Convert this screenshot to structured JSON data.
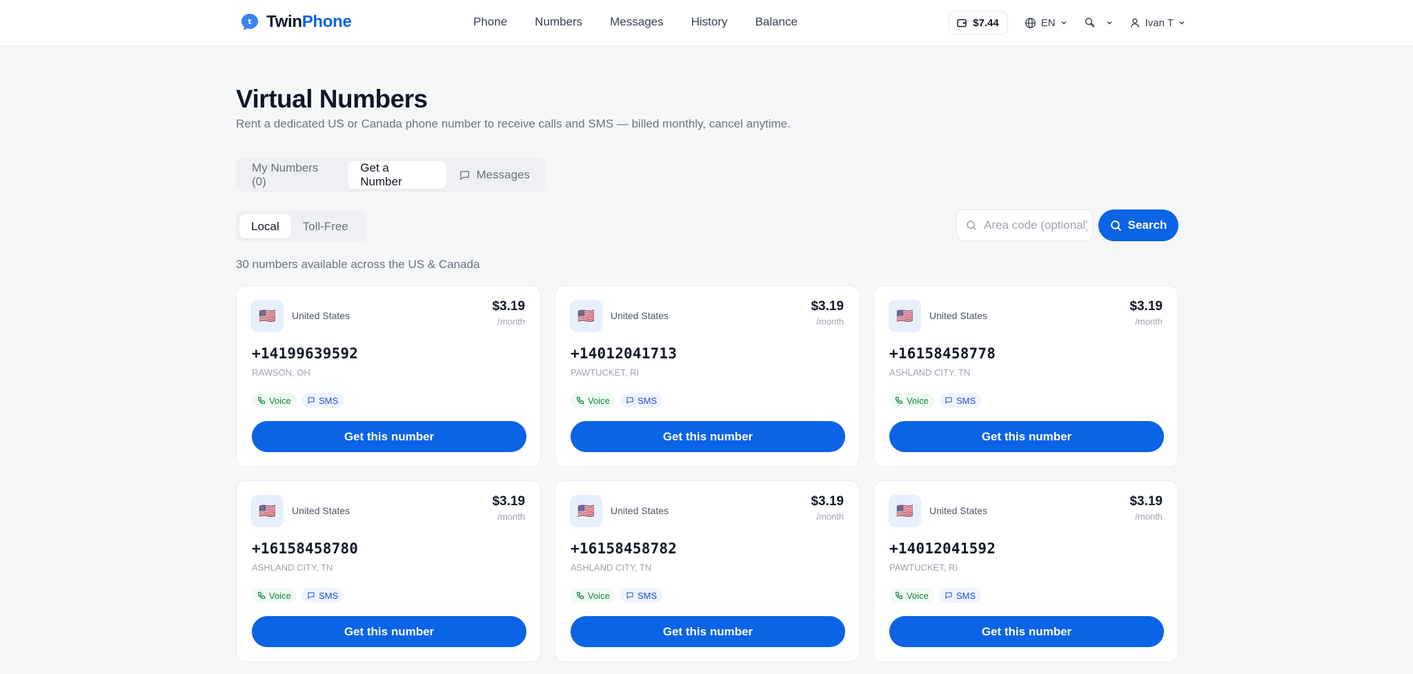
{
  "brand": {
    "name_part1": "Twin",
    "name_part2": "Phone"
  },
  "nav": [
    {
      "label": "Phone"
    },
    {
      "label": "Numbers"
    },
    {
      "label": "Messages"
    },
    {
      "label": "History"
    },
    {
      "label": "Balance"
    }
  ],
  "header": {
    "balance": "$7.44",
    "language": "EN",
    "user": "Ivan T"
  },
  "page": {
    "title": "Virtual Numbers",
    "subtitle": "Rent a dedicated US or Canada phone number to receive calls and SMS — billed monthly, cancel anytime."
  },
  "tabs": [
    {
      "label": "My Numbers (0)",
      "active": false
    },
    {
      "label": "Get a Number",
      "active": true
    },
    {
      "label": "Messages",
      "active": false
    }
  ],
  "subtabs": [
    {
      "label": "Local",
      "active": true
    },
    {
      "label": "Toll-Free",
      "active": false
    }
  ],
  "search": {
    "placeholder": "Area code (optional)",
    "button_label": "Search"
  },
  "count_text": "30 numbers available across the US & Canada",
  "cards": [
    {
      "flag": "🇺🇸",
      "country": "United States",
      "price": "$3.19",
      "per": "/month",
      "number": "+14199639592",
      "location": "RAWSON, OH",
      "voice": "Voice",
      "sms": "SMS",
      "button": "Get this number"
    },
    {
      "flag": "🇺🇸",
      "country": "United States",
      "price": "$3.19",
      "per": "/month",
      "number": "+14012041713",
      "location": "PAWTUCKET, RI",
      "voice": "Voice",
      "sms": "SMS",
      "button": "Get this number"
    },
    {
      "flag": "🇺🇸",
      "country": "United States",
      "price": "$3.19",
      "per": "/month",
      "number": "+16158458778",
      "location": "ASHLAND CITY, TN",
      "voice": "Voice",
      "sms": "SMS",
      "button": "Get this number"
    },
    {
      "flag": "🇺🇸",
      "country": "United States",
      "price": "$3.19",
      "per": "/month",
      "number": "+16158458780",
      "location": "ASHLAND CITY, TN",
      "voice": "Voice",
      "sms": "SMS",
      "button": "Get this number"
    },
    {
      "flag": "🇺🇸",
      "country": "United States",
      "price": "$3.19",
      "per": "/month",
      "number": "+16158458782",
      "location": "ASHLAND CITY, TN",
      "voice": "Voice",
      "sms": "SMS",
      "button": "Get this number"
    },
    {
      "flag": "🇺🇸",
      "country": "United States",
      "price": "$3.19",
      "per": "/month",
      "number": "+14012041592",
      "location": "PAWTUCKET, RI",
      "voice": "Voice",
      "sms": "SMS",
      "button": "Get this number"
    }
  ],
  "colors": {
    "accent": "#0b63e5",
    "voice": "#15803d",
    "sms": "#1d4ed8"
  }
}
